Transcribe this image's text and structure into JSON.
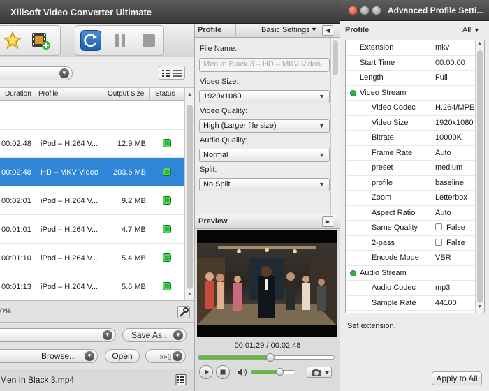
{
  "main": {
    "title": "Xilisoft Video Converter Ultimate",
    "list": {
      "headers": [
        "Duration",
        "Profile",
        "Output Size",
        "Status"
      ],
      "rows": [
        {
          "duration": "00:02:48",
          "profile": "iPod – H.264 V...",
          "size": "12.9 MB",
          "selected": false
        },
        {
          "duration": "00:02:48",
          "profile": "HD – MKV Video",
          "size": "203.6 MB",
          "selected": true
        },
        {
          "duration": "00:02:01",
          "profile": "iPod – H.264 V...",
          "size": "9.2 MB",
          "selected": false
        },
        {
          "duration": "00:01:01",
          "profile": "iPod – H.264 V...",
          "size": "4.7 MB",
          "selected": false
        },
        {
          "duration": "00:01:10",
          "profile": "iPod – H.264 V...",
          "size": "5.4 MB",
          "selected": false
        },
        {
          "duration": "00:01:13",
          "profile": "iPod – H.264 V...",
          "size": "5.6 MB",
          "selected": false
        }
      ]
    },
    "progress_text": "0%",
    "save_as_label": "Save As...",
    "browse_label": "Browse...",
    "open_label": "Open",
    "output_file": "Men In Black 3.mp4"
  },
  "profile_panel": {
    "header": "Profile",
    "basic_settings": "Basic Settings",
    "file_name_label": "File Name:",
    "file_name_placeholder": "Men In Black 3 – HD – MKV Video",
    "video_size_label": "Video Size:",
    "video_size": "1920x1080",
    "video_quality_label": "Video Quality:",
    "video_quality": "High (Larger file size)",
    "audio_quality_label": "Audio Quality:",
    "audio_quality": "Normal",
    "split_label": "Split:",
    "split": "No Split"
  },
  "preview": {
    "header": "Preview",
    "time": "00:01:29 / 00:02:48",
    "progress_fraction": 0.53,
    "volume_fraction": 0.65
  },
  "advanced": {
    "title": "Advanced Profile Setti...",
    "profile_label": "Profile",
    "profile_filter": "All",
    "rows": [
      {
        "key": "Extension",
        "value": "mkv",
        "indent": 1
      },
      {
        "key": "Start Time",
        "value": "00:00:00",
        "indent": 1
      },
      {
        "key": "Length",
        "value": "Full",
        "indent": 1
      },
      {
        "key": "Video Stream",
        "value": "",
        "indent": 0,
        "section": true
      },
      {
        "key": "Video Codec",
        "value": "H.264/MPE",
        "indent": 2
      },
      {
        "key": "Video Size",
        "value": "1920x1080",
        "indent": 2
      },
      {
        "key": "Bitrate",
        "value": "10000K",
        "indent": 2
      },
      {
        "key": "Frame Rate",
        "value": "Auto",
        "indent": 2
      },
      {
        "key": "preset",
        "value": "medium",
        "indent": 2
      },
      {
        "key": "profile",
        "value": "baseline",
        "indent": 2
      },
      {
        "key": "Zoom",
        "value": "Letterbox",
        "indent": 2
      },
      {
        "key": "Aspect Ratio",
        "value": "Auto",
        "indent": 2
      },
      {
        "key": "Same Quality",
        "value": "False",
        "indent": 2,
        "checkbox": true
      },
      {
        "key": "2-pass",
        "value": "False",
        "indent": 2,
        "checkbox": true
      },
      {
        "key": "Encode Mode",
        "value": "VBR",
        "indent": 2
      },
      {
        "key": "Audio Stream",
        "value": "",
        "indent": 0,
        "section": true
      },
      {
        "key": "Audio Codec",
        "value": "mp3",
        "indent": 2
      },
      {
        "key": "Sample Rate",
        "value": "44100",
        "indent": 2
      }
    ],
    "description": "Set extension.",
    "apply_all_label": "Apply to All"
  }
}
